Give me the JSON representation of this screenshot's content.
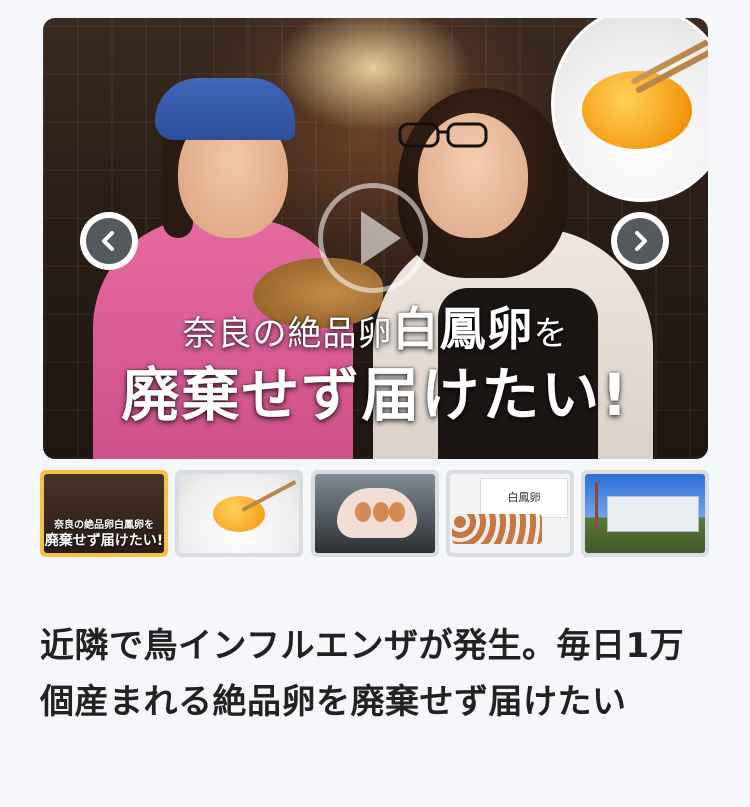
{
  "hero": {
    "line1_prefix": "奈良の絶品卵",
    "line1_highlight": "白鳳卵",
    "line1_suffix": "を",
    "line2": "廃棄せず届けたい!"
  },
  "thumbnails": [
    {
      "id": 1,
      "active": true,
      "caption_line1": "奈良の絶品卵白鳳卵を",
      "caption_line2": "廃棄せず届けたい!"
    },
    {
      "id": 2,
      "active": false
    },
    {
      "id": 3,
      "active": false
    },
    {
      "id": 4,
      "active": false,
      "box_text": "白鳳卵"
    },
    {
      "id": 5,
      "active": false
    }
  ],
  "project": {
    "title": "近隣で鳥インフルエンザが発生。毎日1万個産まれる絶品卵を廃棄せず届けたい"
  },
  "colors": {
    "active_thumb_border": "#f6c14b",
    "inactive_thumb_border": "#d8dde3",
    "arrow_fill": "#555a60",
    "title_text": "#222222",
    "page_bg": "#f5f7fa"
  },
  "icons": {
    "prev": "chevron-left-icon",
    "next": "chevron-right-icon",
    "play": "play-icon"
  }
}
